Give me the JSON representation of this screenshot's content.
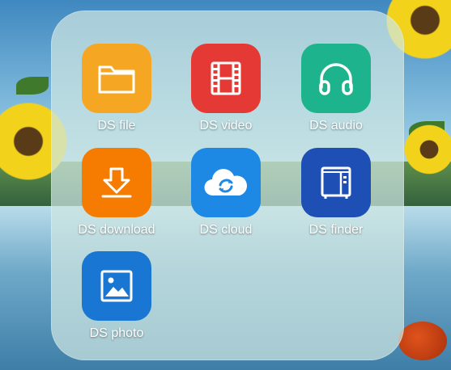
{
  "folder": {
    "apps": [
      {
        "label": "DS file",
        "icon": "folder-icon",
        "color": "#F5A623"
      },
      {
        "label": "DS video",
        "icon": "film-icon",
        "color": "#E53935"
      },
      {
        "label": "DS audio",
        "icon": "headphones-icon",
        "color": "#1DB38C"
      },
      {
        "label": "DS download",
        "icon": "download-icon",
        "color": "#F57C00"
      },
      {
        "label": "DS cloud",
        "icon": "cloud-sync-icon",
        "color": "#1E88E5"
      },
      {
        "label": "DS finder",
        "icon": "nas-icon",
        "color": "#1E4FB5"
      },
      {
        "label": "DS photo",
        "icon": "photo-icon",
        "color": "#1976D2"
      }
    ]
  }
}
